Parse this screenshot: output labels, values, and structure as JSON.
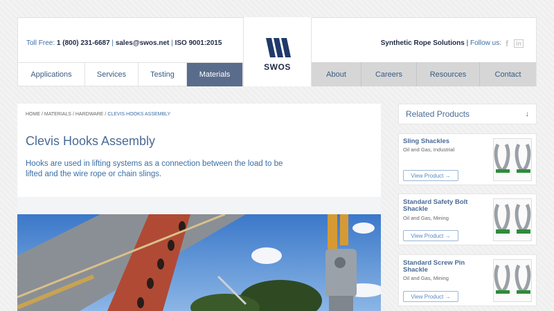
{
  "header": {
    "toll_free_label": "Toll Free:",
    "phone": "1 (800) 231-6687",
    "email": "sales@swos.net",
    "iso": "ISO 9001:2015",
    "separator": "|",
    "tagline": "Synthetic Rope Solutions",
    "follow_label": "Follow us:",
    "social": [
      "f",
      "in"
    ],
    "logo_text": "SWOS"
  },
  "nav_left": [
    "Applications",
    "Services",
    "Testing",
    "Materials"
  ],
  "nav_right": [
    "About",
    "Careers",
    "Resources",
    "Contact"
  ],
  "active_nav": "Materials",
  "breadcrumb": [
    "HOME",
    "MATERIALS",
    "HARDWARE",
    "CLEVIS HOOKS ASSEMBLY"
  ],
  "breadcrumb_separator": "/",
  "main": {
    "title": "Clevis Hooks Assembly",
    "intro": "Hooks are used in lifting systems as a connection between the load to be lifted and the wire rope or chain slings."
  },
  "sidebar": {
    "heading": "Related Products",
    "products": [
      {
        "name": "Sling Shackles",
        "category": "Oil and Gas, Industrial",
        "button": "View Product →"
      },
      {
        "name": "Standard Safety Bolt Shackle",
        "category": "Oil and Gas, Mining",
        "button": "View Product →"
      },
      {
        "name": "Standard Screw Pin Shackle",
        "category": "Oil and Gas, Mining",
        "button": "View Product →"
      }
    ]
  },
  "colors": {
    "accent_blue": "#3a6ea5",
    "nav_active": "#5a6c8c",
    "nav_right_bg": "#d6d6d6",
    "dark_navy": "#1f2a44"
  },
  "icons": [
    "facebook-icon",
    "linkedin-icon",
    "chevron-down-icon",
    "arrow-right-icon"
  ]
}
